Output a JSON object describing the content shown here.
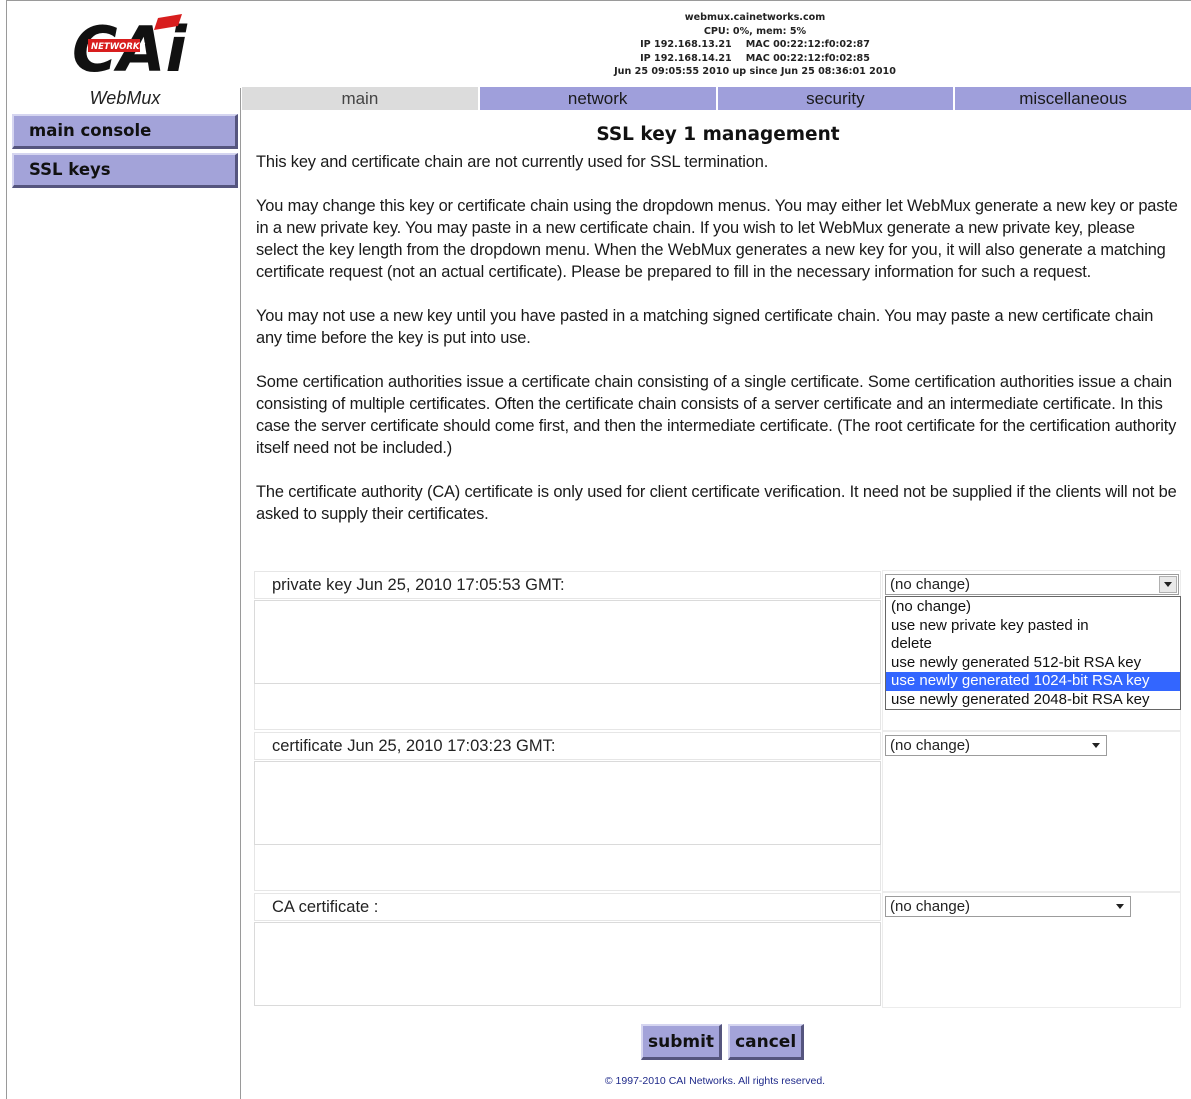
{
  "brand": {
    "logo_text": "CAi",
    "logo_badge": "NETWORKS",
    "product": "WebMux",
    "colors": {
      "logo_black": "#111111",
      "logo_red": "#d81e1e"
    }
  },
  "server_info": {
    "hostname": "webmux.cainetworks.com",
    "load": "CPU: 0%, mem: 5%",
    "ip1": "IP 192.168.13.21",
    "mac1": "MAC 00:22:12:f0:02:87",
    "ip2": "IP 192.168.14.21",
    "mac2": "MAC 00:22:12:f0:02:85",
    "uptime": "Jun 25 09:05:55 2010 up since Jun 25 08:36:01 2010"
  },
  "tabs": [
    {
      "label": "main",
      "active": true
    },
    {
      "label": "network",
      "active": false
    },
    {
      "label": "security",
      "active": false
    },
    {
      "label": "miscellaneous",
      "active": false
    }
  ],
  "sidebar": {
    "items": [
      {
        "label": "main console"
      },
      {
        "label": "SSL keys"
      }
    ]
  },
  "page": {
    "title": "SSL key 1 management",
    "status": "This key and certificate chain are not currently used for SSL termination.",
    "paragraphs": [
      "You may change this key or certificate chain using the dropdown menus. You may either let WebMux generate a new key or paste in a new private key. You may paste in a new certificate chain. If you wish to let WebMux generate a new private key, please select the key length from the dropdown menu. When the WebMux generates a new key for you, it will also generate a matching certificate request (not an actual certificate). Please be prepared to fill in the necessary information for such a request.",
      "You may not use a new key until you have pasted in a matching signed certificate chain. You may paste a new certificate chain any time before the key is put into use.",
      "Some certification authorities issue a certificate chain consisting of a single certificate. Some certification authorities issue a chain consisting of multiple certificates. Often the certificate chain consists of a server certificate and an intermediate certificate. In this case the server certificate should come first, and then the intermediate certificate. (The root certificate for the certification authority itself need not be included.)",
      "The certificate authority (CA) certificate is only used for client certificate verification. It need not be supplied if the clients will not be asked to supply their certificates."
    ]
  },
  "form": {
    "private_key": {
      "label": "private key Jun 25, 2010 17:05:53 GMT:",
      "selected": "(no change)",
      "options": [
        "(no change)",
        "use new private key pasted in",
        "delete",
        "use newly generated 512-bit RSA key",
        "use newly generated 1024-bit RSA key",
        "use newly generated 2048-bit RSA key"
      ],
      "highlighted_option": "use newly generated 1024-bit RSA key"
    },
    "certificate": {
      "label": "certificate Jun 25, 2010 17:03:23 GMT:",
      "selected": "(no change)"
    },
    "ca_certificate": {
      "label": "CA certificate :",
      "selected": "(no change)"
    }
  },
  "actions": {
    "submit": "submit",
    "cancel": "cancel"
  },
  "footer": "© 1997-2010 CAI Networks. All rights reserved.",
  "colors": {
    "tab_bg": "#9f9fdb",
    "tab_active_bg": "#dcdcdc",
    "button_bg": "#a3a3d9",
    "highlight": "#3366ff"
  }
}
